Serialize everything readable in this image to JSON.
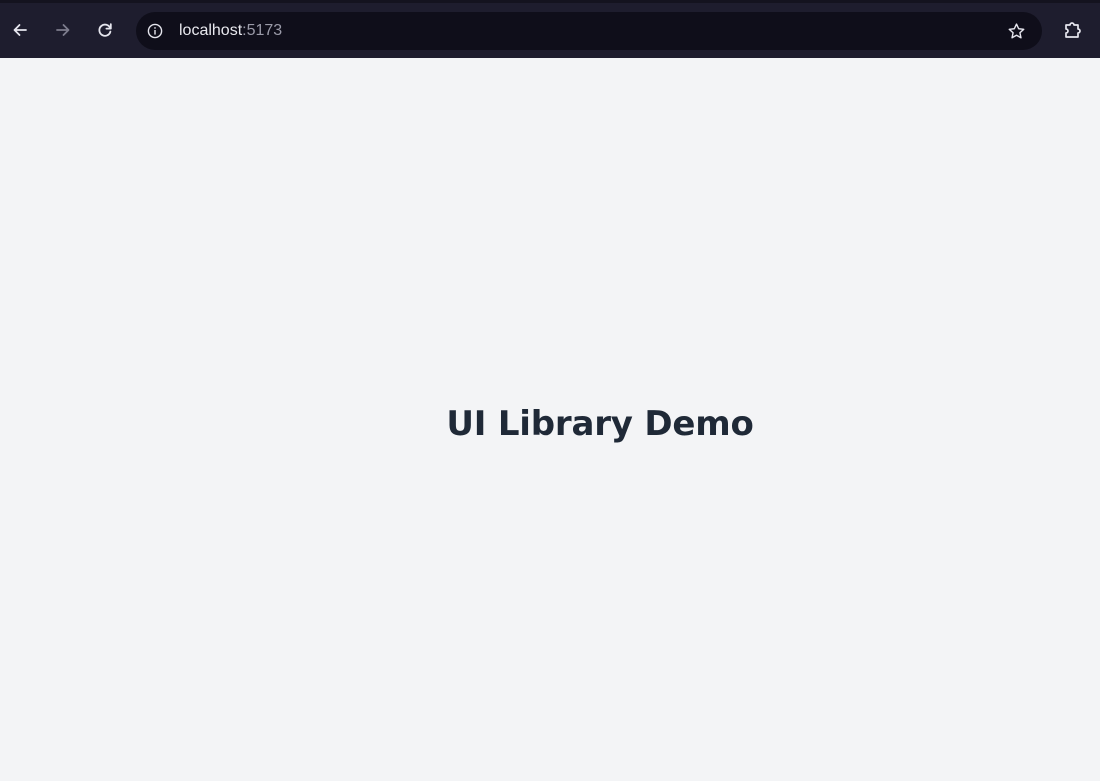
{
  "browser": {
    "url_host": "localhost",
    "url_port": ":5173",
    "icons": {
      "back": "back-arrow-icon",
      "forward": "forward-arrow-icon",
      "reload": "reload-icon",
      "site_info": "info-icon",
      "bookmark": "star-icon",
      "extensions": "puzzle-icon"
    },
    "colors": {
      "toolbar_bg": "#1e1d2e",
      "omnibox_bg": "#0f0e1a"
    }
  },
  "page": {
    "heading": "UI Library Demo",
    "colors": {
      "background": "#f3f4f6",
      "heading": "#1f2937"
    }
  }
}
